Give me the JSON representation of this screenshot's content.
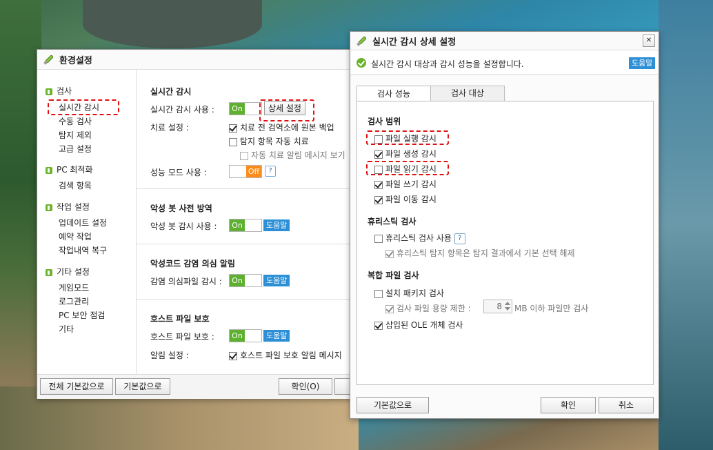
{
  "main_window": {
    "title": "환경설정",
    "sidebar": {
      "groups": [
        {
          "label": "검사",
          "items": [
            "실시간 감시",
            "수동 검사",
            "탐지 제외",
            "고급 설정"
          ]
        },
        {
          "label": "PC 최적화",
          "items": [
            "검색 항목"
          ]
        },
        {
          "label": "작업 설정",
          "items": [
            "업데이트 설정",
            "예약 작업",
            "작업내역 복구"
          ]
        },
        {
          "label": "기타 설정",
          "items": [
            "게임모드",
            "로그관리",
            "PC 보안 점검",
            "기타"
          ]
        }
      ]
    },
    "realtime": {
      "title": "실시간 감시",
      "use_label": "실시간 감시 사용 :",
      "toggle_on": "On",
      "detail_button": "상세 설정",
      "treat_label": "치료 설정 :",
      "opt_backup": "치료 전 검역소에 원본 백업",
      "opt_auto": "탐지 항목 자동 치료",
      "opt_alert": "자동 치료 알림 메시지 보기",
      "perf_label": "성능 모드 사용 :",
      "toggle_off": "Off",
      "q": "?"
    },
    "bot": {
      "title": "악성 봇 사전 방역",
      "label": "악성 봇 감시 사용 :",
      "toggle": "On",
      "help": "도움말"
    },
    "infection": {
      "title": "악성코드 감염 의심 알림",
      "label": "감염 의심파일 감시 :",
      "toggle": "On",
      "help": "도움말"
    },
    "host": {
      "title": "호스트 파일 보호",
      "label": "호스트 파일 보호 :",
      "toggle": "On",
      "help": "도움말",
      "alert_label": "알림 설정 :",
      "alert_opt": "호스트 파일 보호 알림 메시지"
    },
    "footer": {
      "reset_all": "전체 기본값으로",
      "reset": "기본값으로",
      "ok": "확인(O)"
    }
  },
  "detail_window": {
    "title": "실시간 감시 상세 설정",
    "close": "✕",
    "info": "실시간 감시 대상과 감시 성능을 설정합니다.",
    "help": "도움말",
    "tabs": [
      "검사 성능",
      "검사 대상"
    ],
    "scan_range": {
      "title": "검사 범위",
      "items": [
        {
          "label": "파일 실행 감시",
          "checked": false
        },
        {
          "label": "파일 생성 감시",
          "checked": true
        },
        {
          "label": "파일 읽기 감시",
          "checked": false
        },
        {
          "label": "파일 쓰기 감시",
          "checked": true
        },
        {
          "label": "파일 이동 감시",
          "checked": true
        }
      ]
    },
    "heuristic": {
      "title": "휴리스틱 검사",
      "use": "휴리스틱 검사 사용",
      "q": "?",
      "sub": "휴리스틱 탐지 항목은 탐지 결과에서 기본 선택 해제"
    },
    "compound": {
      "title": "복합 파일 검사",
      "install": "설치 패키지 검사",
      "size_limit": "검사 파일 용량 제한 :",
      "size_value": "8",
      "size_suffix": "MB 이하 파일만 검사",
      "ole": "삽입된 OLE 개체 검사"
    },
    "footer": {
      "reset": "기본값으로",
      "ok": "확인",
      "cancel": "취소"
    }
  }
}
